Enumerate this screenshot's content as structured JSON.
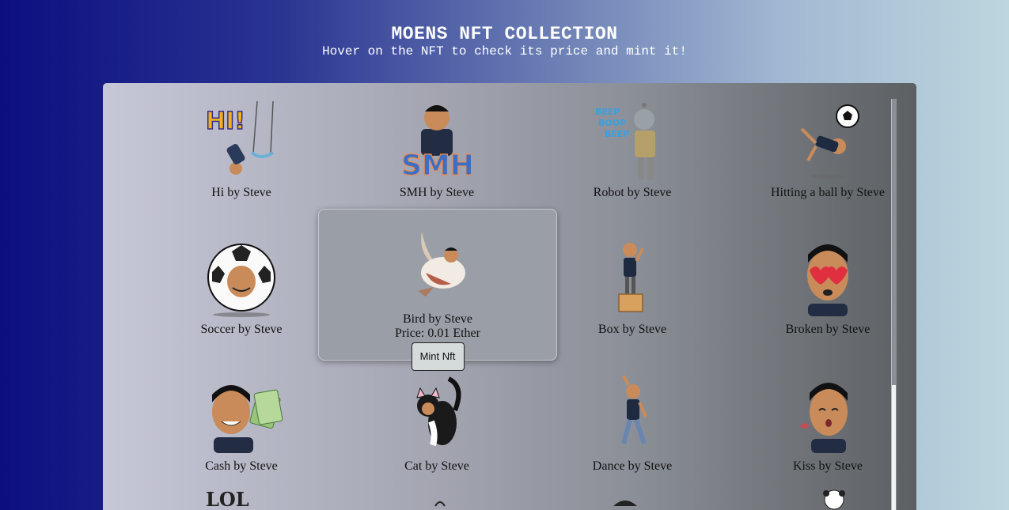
{
  "header": {
    "title": "MOENS NFT COLLECTION",
    "subtitle": "Hover on the NFT to check its price and mint it!"
  },
  "nfts": [
    {
      "label": "Hi by Steve",
      "icon": "hi-sticker-icon"
    },
    {
      "label": "SMH by Steve",
      "icon": "smh-sticker-icon"
    },
    {
      "label": "Robot by Steve",
      "icon": "robot-sticker-icon"
    },
    {
      "label": "Hitting a ball by Steve",
      "icon": "kick-ball-sticker-icon"
    },
    {
      "label": "Soccer by Steve",
      "icon": "soccer-ball-sticker-icon"
    },
    {
      "label": "Bird by Steve",
      "icon": "bird-sticker-icon",
      "price": "Price: 0.01 Ether",
      "mint": "Mint Nft"
    },
    {
      "label": "Box by Steve",
      "icon": "box-sticker-icon"
    },
    {
      "label": "Broken by Steve",
      "icon": "broken-heart-sticker-icon"
    },
    {
      "label": "Cash by Steve",
      "icon": "cash-sticker-icon"
    },
    {
      "label": "Cat by Steve",
      "icon": "cat-sticker-icon"
    },
    {
      "label": "Dance by Steve",
      "icon": "dance-sticker-icon"
    },
    {
      "label": "Kiss by Steve",
      "icon": "kiss-sticker-icon"
    }
  ],
  "colors": {
    "panel_dark": "#5c6063",
    "panel_light": "#c6c7d7",
    "header_text": "#ffffff"
  }
}
